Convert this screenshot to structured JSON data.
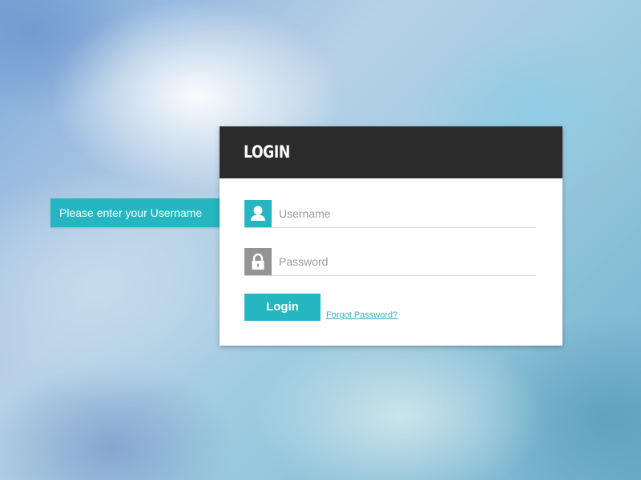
{
  "tooltip": {
    "text": "Please enter your Username"
  },
  "login": {
    "title": "Login",
    "username": {
      "placeholder": "Username",
      "value": "",
      "icon": "user-icon"
    },
    "password": {
      "placeholder": "Password",
      "value": "",
      "icon": "lock-icon"
    },
    "button_label": "Login",
    "forgot_link": "Forgot Password?"
  },
  "colors": {
    "accent": "#25b6c2",
    "header_bg": "#2b2b2b",
    "lock_icon_bg": "#949494",
    "card_bg": "#ffffff"
  }
}
